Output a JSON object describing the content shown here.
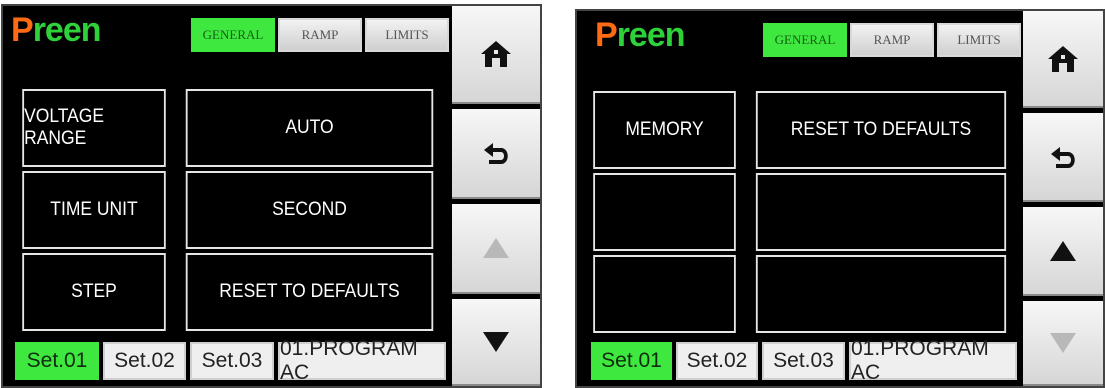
{
  "brand": {
    "p": "P",
    "rest": "reen"
  },
  "tabs": {
    "general": "GENERAL",
    "ramp": "RAMP",
    "limits": "LIMITS"
  },
  "left": {
    "rows": [
      {
        "label": "VOLTAGE RANGE",
        "value": "AUTO"
      },
      {
        "label": "TIME UNIT",
        "value": "SECOND"
      },
      {
        "label": "STEP",
        "value": "RESET TO DEFAULTS"
      }
    ],
    "up_enabled": false,
    "down_enabled": true
  },
  "right": {
    "rows": [
      {
        "label": "MEMORY",
        "value": "RESET TO DEFAULTS"
      },
      {
        "label": "",
        "value": ""
      },
      {
        "label": "",
        "value": ""
      }
    ],
    "up_enabled": true,
    "down_enabled": false
  },
  "sets": {
    "s1": "Set.01",
    "s2": "Set.02",
    "s3": "Set.03"
  },
  "program": "01.PROGRAM AC",
  "icons": {
    "home": "home-icon",
    "back": "back-arrow-icon",
    "up": "up-arrow-icon",
    "down": "down-arrow-icon"
  },
  "colors": {
    "active_green": "#3fe83f",
    "brand_orange": "#ff6a13",
    "brand_green": "#2fd13a",
    "background": "#000000"
  }
}
